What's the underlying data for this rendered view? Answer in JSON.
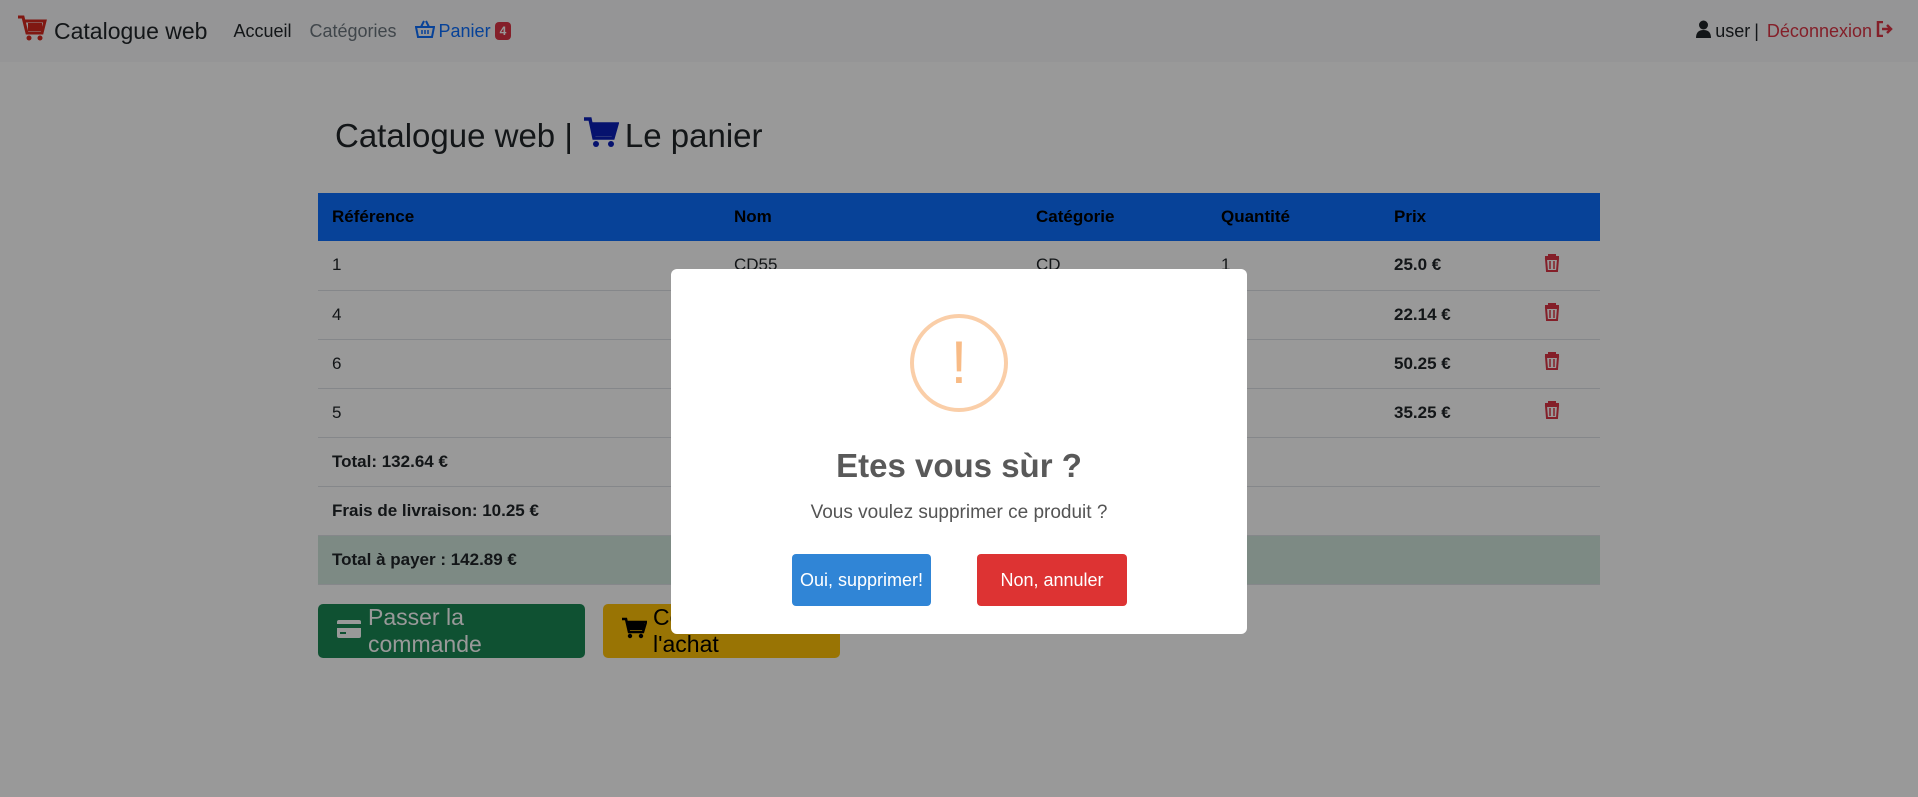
{
  "navbar": {
    "brand": "Catalogue web",
    "home": "Accueil",
    "categories": "Catégories",
    "cart": "Panier",
    "cart_count": "4",
    "user": "user",
    "separator": "|",
    "logout": "Déconnexion"
  },
  "header": {
    "brand": "Catalogue web |",
    "cart_title": "Le panier"
  },
  "table": {
    "columns": [
      "Référence",
      "Nom",
      "Catégorie",
      "Quantité",
      "Prix",
      ""
    ],
    "rows": [
      {
        "ref": "1",
        "name": "CD55",
        "category": "CD",
        "qty": "1",
        "price": "25.0 €"
      },
      {
        "ref": "4",
        "name": "",
        "category": "",
        "qty": "",
        "price": "22.14 €"
      },
      {
        "ref": "6",
        "name": "",
        "category": "",
        "qty": "",
        "price": "50.25 €"
      },
      {
        "ref": "5",
        "name": "",
        "category": "",
        "qty": "",
        "price": "35.25 €"
      }
    ],
    "total": "Total: 132.64 €",
    "shipping": "Frais de livraison: 10.25 €",
    "total_to_pay": "Total à payer : 142.89 €"
  },
  "actions": {
    "order": "Passer la commande",
    "continue": "Continuer l'achat"
  },
  "modal": {
    "icon": "!",
    "title": "Etes vous sùr ?",
    "text": "Vous voulez supprimer ce produit ?",
    "confirm": "Oui, supprimer!",
    "cancel": "Non, annuler"
  },
  "colors": {
    "primary": "#0d6efd",
    "danger": "#dc3545",
    "success": "#198754",
    "warning": "#ffc107",
    "confirm": "#3085d6",
    "cancel": "#dd3333",
    "warn_icon": "#f8bb86"
  },
  "icons": {
    "brand": "cart-logo-icon",
    "cart": "basket-icon",
    "user": "user-icon",
    "logout": "sign-out-icon",
    "header_cart": "shopping-cart-icon",
    "trash": "trash-icon",
    "order": "credit-card-icon",
    "continue": "shopping-cart-icon",
    "modal": "warning-icon"
  }
}
